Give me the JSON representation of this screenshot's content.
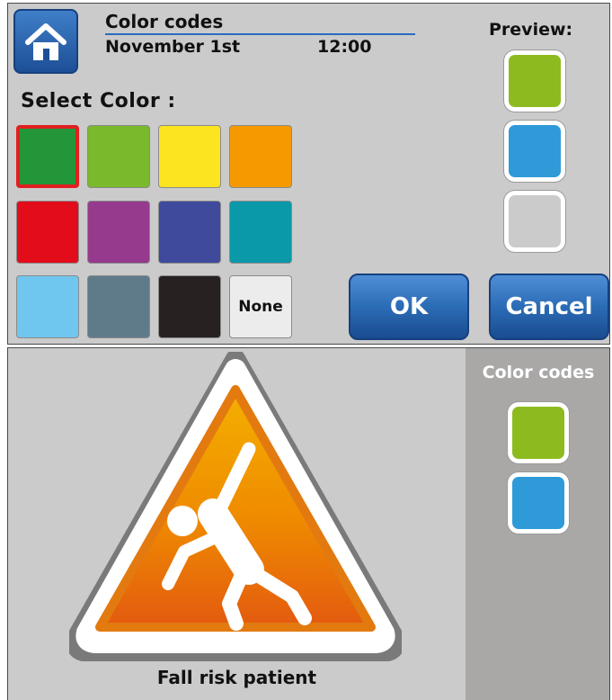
{
  "header": {
    "title": "Color codes",
    "date": "November 1st",
    "time": "12:00"
  },
  "preview": {
    "label": "Preview:",
    "swatches": [
      "#8dbb1f",
      "#2e9bd8",
      "#cbcbcb"
    ]
  },
  "palette": {
    "label": "Select Color :",
    "colors": [
      "#23963a",
      "#7ab82c",
      "#fde421",
      "#f49a00",
      "#e30c1a",
      "#963a8e",
      "#3f4a9c",
      "#0a99a8",
      "#6fc7ef",
      "#5f7b8a",
      "#272122"
    ],
    "none_label": "None",
    "selected_index": 0
  },
  "buttons": {
    "ok": "OK",
    "cancel": "Cancel"
  },
  "sidebar": {
    "title": "Color codes",
    "swatches": [
      "#8dbb1f",
      "#2e9bd8"
    ]
  },
  "warning": {
    "caption": "Fall risk patient",
    "icon": "fall-risk-warning-icon"
  }
}
